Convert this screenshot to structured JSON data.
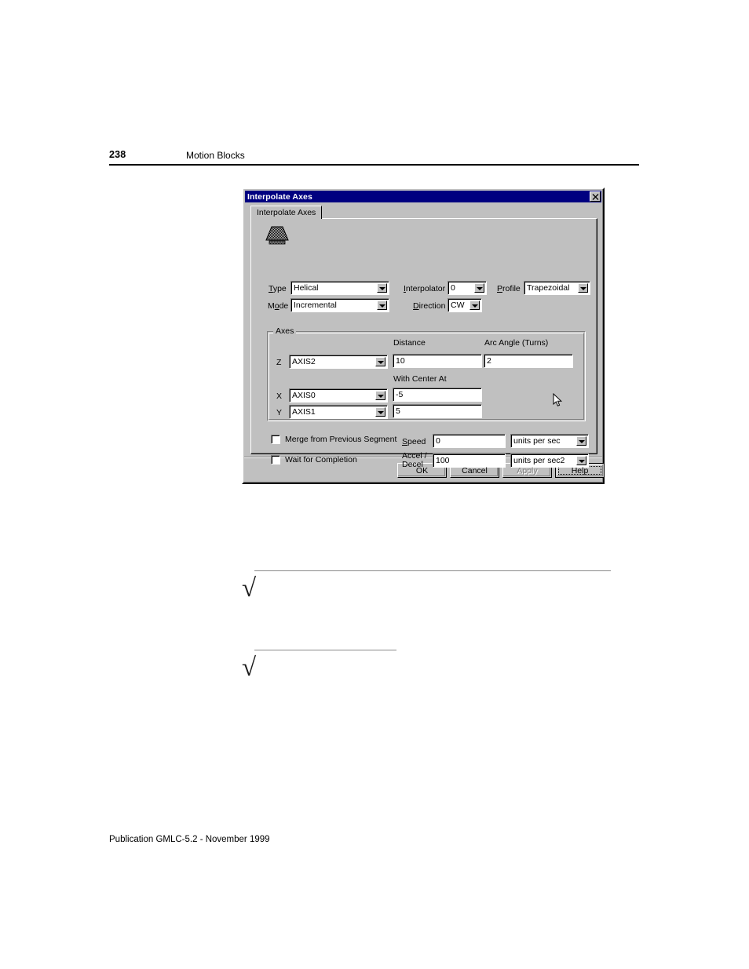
{
  "page": {
    "number": "238",
    "chapter": "Motion Blocks",
    "footer": "Publication GMLC-5.2 - November 1999"
  },
  "dialog": {
    "title": "Interpolate Axes",
    "close_icon": "close-icon",
    "tab": "Interpolate Axes",
    "icon": "trapezoidal-profile-icon",
    "fields": {
      "type_label": "Type",
      "type_value": "Helical",
      "mode_label": "Mode",
      "mode_value": "Incremental",
      "interpolator_label": "Interpolator",
      "interpolator_value": "0",
      "direction_label": "Direction",
      "direction_value": "CW",
      "profile_label": "Profile",
      "profile_value": "Trapezoidal"
    },
    "axes_group": {
      "title": "Axes",
      "distance_header": "Distance",
      "arc_angle_header": "Arc Angle (Turns)",
      "with_center_at_header": "With Center At",
      "rows": [
        {
          "axis_label": "Z",
          "axis_value": "AXIS2",
          "value": "10"
        },
        {
          "axis_label": "X",
          "axis_value": "AXIS0",
          "value": "-5"
        },
        {
          "axis_label": "Y",
          "axis_value": "AXIS1",
          "value": "5"
        }
      ],
      "arc_angle_value": "2"
    },
    "options": {
      "merge_label": "Merge from Previous Segment",
      "merge_checked": false,
      "wait_label": "Wait for Completion",
      "wait_checked": false,
      "speed_label": "Speed",
      "speed_value": "0",
      "speed_units": "units per sec",
      "accel_label_line1": "Accel /",
      "accel_label_line2": "Decel",
      "accel_value": "100",
      "accel_units": "units per sec2"
    },
    "buttons": {
      "ok": "OK",
      "cancel": "Cancel",
      "apply": "Apply",
      "apply_disabled": true,
      "help": "Help",
      "help_focused": true
    }
  },
  "colors": {
    "titlebar": "#000080",
    "dialog_face": "#c0c0c0",
    "field_bg": "#ffffff",
    "disabled_text": "#808080"
  }
}
